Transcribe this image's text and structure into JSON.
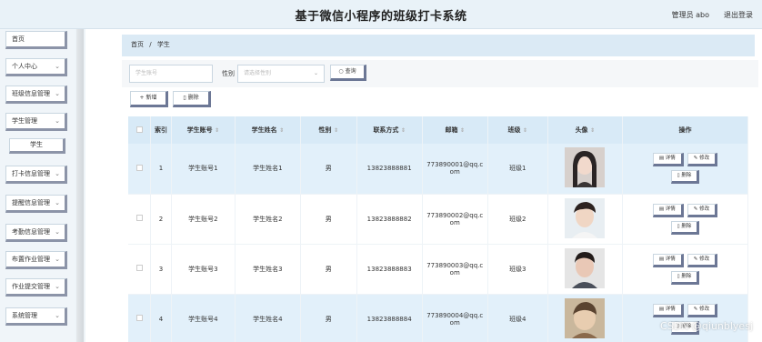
{
  "header": {
    "title": "基于微信小程序的班级打卡系统",
    "user": "管理员 abo",
    "logout": "退出登录"
  },
  "sidebar": {
    "items": [
      {
        "label": "首页",
        "has_chevron": false
      },
      {
        "label": "个人中心",
        "has_chevron": true
      },
      {
        "label": "班级信息管理",
        "has_chevron": true
      },
      {
        "label": "学生管理",
        "has_chevron": true
      },
      {
        "label": "学生",
        "sub": true
      },
      {
        "label": "打卡信息管理",
        "has_chevron": true
      },
      {
        "label": "提醒信息管理",
        "has_chevron": true
      },
      {
        "label": "考勤信息管理",
        "has_chevron": true
      },
      {
        "label": "布置作业管理",
        "has_chevron": true
      },
      {
        "label": "作业提交管理",
        "has_chevron": true
      },
      {
        "label": "系统管理",
        "has_chevron": true
      }
    ]
  },
  "breadcrumb": {
    "home": "首页",
    "sep": "/",
    "current": "学生"
  },
  "search": {
    "student_no_placeholder": "学生账号",
    "gender_label": "性别",
    "gender_placeholder": "请选择性别",
    "query_label": "查询",
    "add_label": "新增",
    "delete_label": "删除"
  },
  "table": {
    "headers": [
      "索引",
      "学生账号",
      "学生姓名",
      "性别",
      "联系方式",
      "邮箱",
      "班级",
      "头像",
      "操作"
    ],
    "rows": [
      {
        "index": "1",
        "student_no": "学生账号1",
        "name": "学生姓名1",
        "gender": "男",
        "phone": "13823888881",
        "email_line1": "773890001@qq.c",
        "email_line2": "om",
        "class": "班级1"
      },
      {
        "index": "2",
        "student_no": "学生账号2",
        "name": "学生姓名2",
        "gender": "男",
        "phone": "13823888882",
        "email_line1": "773890002@qq.c",
        "email_line2": "om",
        "class": "班级2"
      },
      {
        "index": "3",
        "student_no": "学生账号3",
        "name": "学生姓名3",
        "gender": "男",
        "phone": "13823888883",
        "email_line1": "773890003@qq.c",
        "email_line2": "om",
        "class": "班级3"
      },
      {
        "index": "4",
        "student_no": "学生账号4",
        "name": "学生姓名4",
        "gender": "男",
        "phone": "13823888884",
        "email_line1": "773890004@qq.c",
        "email_line2": "om",
        "class": "班级4"
      }
    ],
    "actions": {
      "detail": "详情",
      "edit": "修改",
      "delete": "删除"
    }
  },
  "watermark": "CSDN @qiunblyesj",
  "colors": {
    "header_bg": "#e9f2f8",
    "row_highlight": "#e2f0fa",
    "button_shadow": "#6c7795"
  }
}
